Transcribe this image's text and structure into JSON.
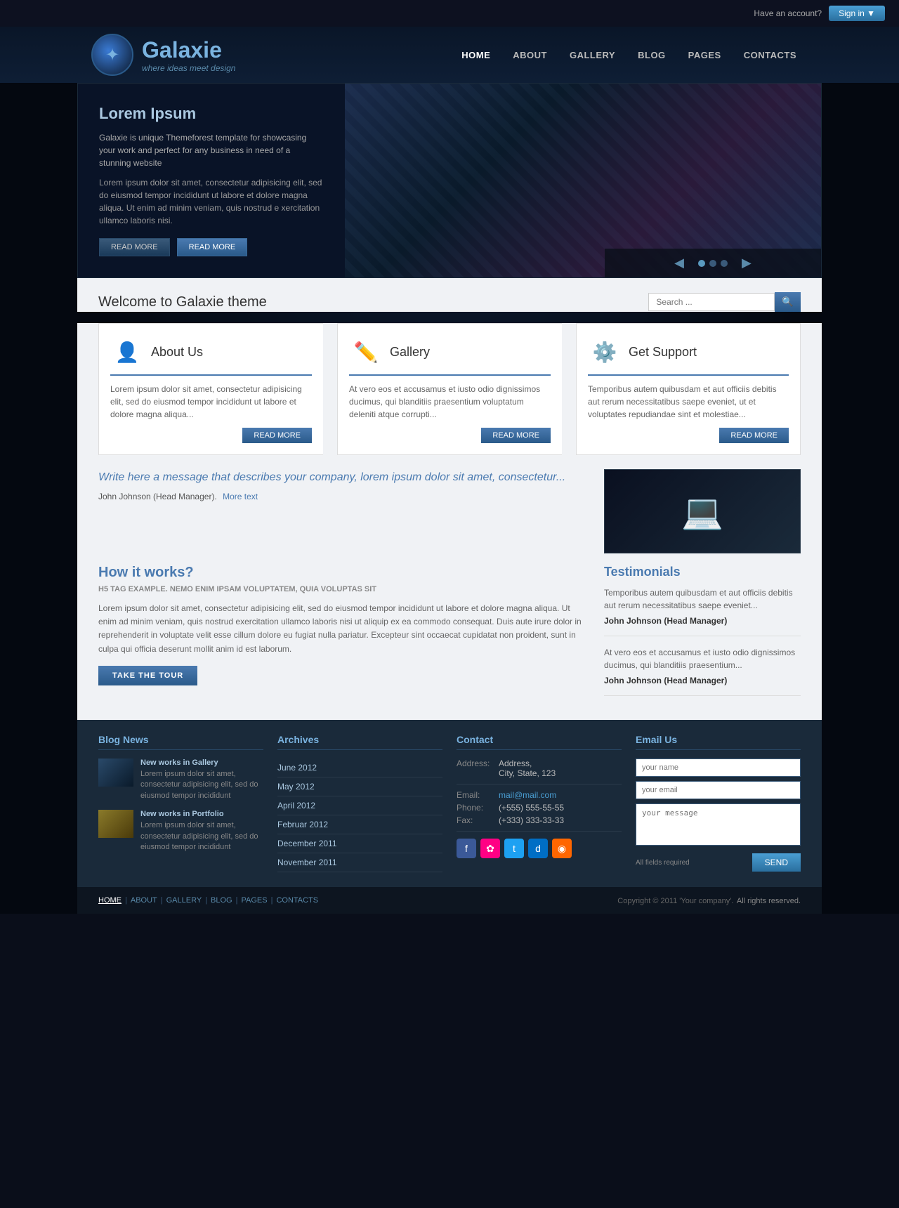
{
  "topbar": {
    "have_account": "Have an account?",
    "sign_in": "Sign in ▼"
  },
  "logo": {
    "title": "Galaxie",
    "subtitle": "where ideas meet design"
  },
  "nav": {
    "items": [
      {
        "label": "HOME",
        "active": true
      },
      {
        "label": "ABOUT",
        "active": false
      },
      {
        "label": "GALLERY",
        "active": false
      },
      {
        "label": "BLOG",
        "active": false
      },
      {
        "label": "PAGES",
        "active": false
      },
      {
        "label": "CONTACTS",
        "active": false
      }
    ]
  },
  "hero": {
    "title": "Lorem Ipsum",
    "desc1": "Galaxie is unique Themeforest template for showcasing your work and perfect for any business in need of a stunning website",
    "desc2": "Lorem ipsum dolor sit amet, consectetur adipisicing elit, sed do eiusmod tempor incididunt ut labore et dolore magna aliqua. Ut enim ad minim veniam, quis nostrud e xercitation ullamco laboris nisi.",
    "btn1": "READ MORE",
    "btn2": "READ MORE"
  },
  "welcome": {
    "title": "Welcome to Galaxie theme",
    "search_placeholder": "Search ..."
  },
  "about": {
    "icon": "👤",
    "title": "About Us",
    "text": "Lorem ipsum dolor sit amet, consectetur adipisicing elit, sed do eiusmod tempor incididunt ut labore et dolore magna aliqua...",
    "btn": "READ MORE"
  },
  "gallery": {
    "icon": "✏️",
    "title": "Gallery",
    "text": "At vero eos et accusamus et iusto odio dignissimos ducimus, qui blanditiis praesentium voluptatum deleniti atque corrupti...",
    "btn": "READ MORE"
  },
  "support": {
    "icon": "⚙️",
    "title": "Get Support",
    "text": "Temporibus autem quibusdam et aut officiis debitis aut rerum necessitatibus saepe eveniet, ut et voluptates repudiandae sint et molestiae...",
    "btn": "READ MORE"
  },
  "quote": {
    "text": "Write here a message that describes your company, lorem ipsum dolor sit amet, consectetur...",
    "author": "John Johnson (Head Manager).",
    "more_text": "More text"
  },
  "how": {
    "title": "How it works?",
    "subtitle": "H5 TAG EXAMPLE. NEMO ENIM IPSAM VOLUPTATEM, QUIA VOLUPTAS SIT",
    "text": "Lorem ipsum dolor sit amet, consectetur adipisicing elit, sed do eiusmod tempor incididunt ut labore et dolore magna aliqua. Ut enim ad minim veniam, quis nostrud exercitation ullamco laboris nisi ut aliquip ex ea commodo consequat. Duis aute irure dolor in reprehenderit in voluptate velit esse cillum dolore eu fugiat nulla pariatur. Excepteur sint occaecat cupidatat non proident, sunt in culpa qui officia deserunt mollit anim id est laborum.",
    "btn": "TAKE THE TOUR"
  },
  "testimonials": {
    "title": "Testimonials",
    "items": [
      {
        "text": "Temporibus autem quibusdam et aut officiis debitis aut rerum necessitatibus saepe eveniet...",
        "author": "John Johnson (Head Manager)"
      },
      {
        "text": "At vero eos et accusamus et iusto odio dignissimos ducimus, qui blanditiis praesentium...",
        "author": "John Johnson (Head Manager)"
      }
    ]
  },
  "blog_news": {
    "title": "Blog News",
    "items": [
      {
        "title": "New works in Gallery",
        "text": "Lorem ipsum dolor sit amet, consectetur adipisicing elit, sed do eiusmod tempor incididunt"
      },
      {
        "title": "New works in Portfolio",
        "text": "Lorem ipsum dolor sit amet, consectetur adipisicing elit, sed do eiusmod tempor incididunt"
      }
    ]
  },
  "archives": {
    "title": "Archives",
    "items": [
      "June 2012",
      "May 2012",
      "April 2012",
      "Februar 2012",
      "December 2011",
      "November 2011"
    ]
  },
  "contact": {
    "title": "Contact",
    "address_label": "Address:",
    "address_value": "Address,\nCity, State, 123",
    "email_label": "Email:",
    "email_value": "mail@mail.com",
    "phone_label": "Phone:",
    "phone_value": "(+555) 555-55-55",
    "fax_label": "Fax:",
    "fax_value": "(+333) 333-33-33"
  },
  "email_us": {
    "title": "Email Us",
    "name_placeholder": "your name",
    "email_placeholder": "your email",
    "message_placeholder": "your message",
    "required_note": "All fields required",
    "send_btn": "SEND"
  },
  "footer_nav": {
    "items": [
      "HOME",
      "ABOUT",
      "GALLERY",
      "BLOG",
      "PAGES",
      "CONTACTS"
    ]
  },
  "footer": {
    "copy": "Copyright © 2011 'Your company'.",
    "rights": "All rights reserved."
  }
}
